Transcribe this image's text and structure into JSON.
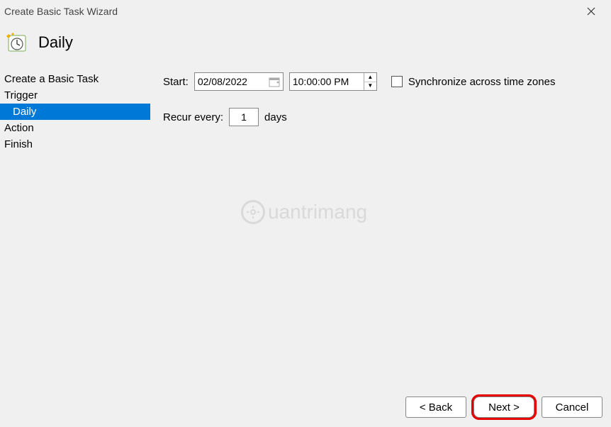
{
  "window": {
    "title": "Create Basic Task Wizard",
    "close_icon": "close-icon"
  },
  "header": {
    "icon": "scheduled-clock-icon",
    "heading": "Daily"
  },
  "sidebar": {
    "items": [
      {
        "label": "Create a Basic Task",
        "selected": false,
        "child": false
      },
      {
        "label": "Trigger",
        "selected": false,
        "child": false
      },
      {
        "label": "Daily",
        "selected": true,
        "child": true
      },
      {
        "label": "Action",
        "selected": false,
        "child": false
      },
      {
        "label": "Finish",
        "selected": false,
        "child": false
      }
    ]
  },
  "form": {
    "start_label": "Start:",
    "date_value": "02/08/2022",
    "time_value": "10:00:00 PM",
    "sync_label": "Synchronize across time zones",
    "sync_checked": false,
    "recur_label": "Recur every:",
    "recur_value": "1",
    "recur_unit": "days"
  },
  "footer": {
    "back_label": "< Back",
    "next_label": "Next >",
    "cancel_label": "Cancel"
  },
  "watermark": "uantrimang"
}
